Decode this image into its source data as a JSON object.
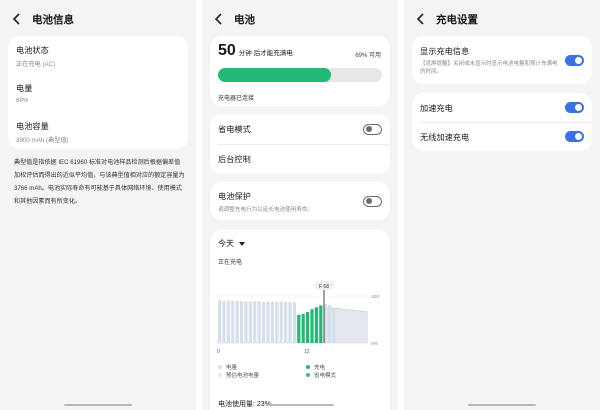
{
  "panel1": {
    "title": "电池信息",
    "items": [
      {
        "label": "电池状态",
        "value": "正在充电 (AC)"
      },
      {
        "label": "电量",
        "value": "69%"
      },
      {
        "label": "电池容量",
        "value": "3900 mAh (典型值)"
      }
    ],
    "description": "典型值是指依据 IEC 61960 标准对电池样品检测后根据偏差值加权评估而得出的近似平均值，与该典型值相对应的额定容量为 3766 mAh。电池实际寿命有可能基于具体网络环境、使用模式和其他因素而有所变化。"
  },
  "panel2": {
    "title": "电池",
    "time_number": "50",
    "time_unit": "分钟",
    "time_suffix": "后才能充满电",
    "percent_label": "69% 可用",
    "progress": 0.69,
    "charger_status": "充电器已连接",
    "power_saving": {
      "label": "省电模式",
      "on": false
    },
    "background_control": "后台控制",
    "battery_protect": {
      "label": "电池保护",
      "desc": "调调整充电行为以延长电池使用寿命。",
      "on": false
    },
    "usage": {
      "period": "今天",
      "status": "正在充电",
      "marker": "F 68",
      "y_top": "100",
      "y_bottom": "0%",
      "x_ticks": [
        "0",
        "12"
      ],
      "legend": [
        "电量",
        "充电",
        "预估电池电量",
        "省电模式"
      ]
    },
    "footer_partial": "电池使用量: 23%"
  },
  "panel3": {
    "title": "充电设置",
    "show_info": {
      "label": "显示充电信息",
      "desc": "【息屏提醒】关闭或未显示时显示电池电量和预计充满电的时间。",
      "on": true
    },
    "fast_charge": {
      "label": "加速充电",
      "on": true
    },
    "wireless_fast_charge": {
      "label": "无线加速充电",
      "on": true
    }
  },
  "colors": {
    "accent_green": "#22b875",
    "toggle_blue": "#3a72e6",
    "bar_blue": "#d5e0ec",
    "legend_light": "#e3e8ee",
    "legend_teal": "#29bfa6"
  }
}
